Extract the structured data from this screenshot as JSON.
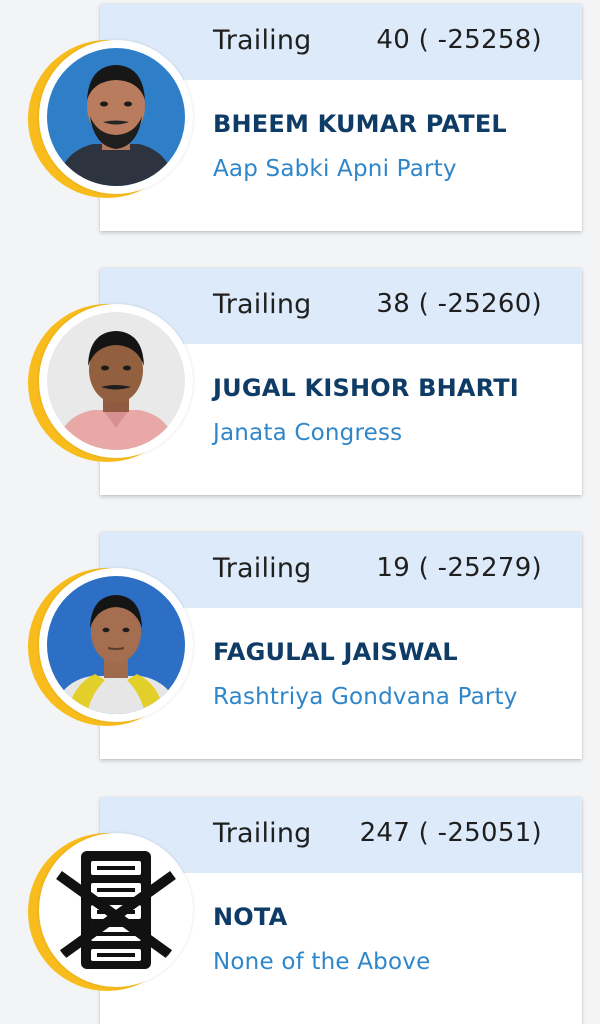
{
  "candidates": [
    {
      "status": "Trailing",
      "votes": "40 ( -25258)",
      "name": "BHEEM KUMAR PATEL",
      "party": "Aap Sabki Apni Party",
      "photo_icon": "candidate-photo-icon",
      "photo_bg": "#2f7fc8"
    },
    {
      "status": "Trailing",
      "votes": "38 ( -25260)",
      "name": "JUGAL KISHOR BHARTI",
      "party": "Janata Congress",
      "photo_icon": "candidate-photo-icon",
      "photo_bg": "#e9e9e9"
    },
    {
      "status": "Trailing",
      "votes": "19 ( -25279)",
      "name": "FAGULAL JAISWAL",
      "party": "Rashtriya Gondvana Party",
      "photo_icon": "candidate-photo-icon",
      "photo_bg": "#2c6fc4"
    },
    {
      "status": "Trailing",
      "votes": "247 ( -25051)",
      "name": "NOTA",
      "party": "None of the Above",
      "photo_icon": "nota-symbol-icon",
      "photo_bg": "#ffffff"
    }
  ],
  "colors": {
    "header_bg": "#ddeaf9",
    "name_color": "#0f3c66",
    "party_color": "#2f86c9",
    "ring_accent": "#f8bc1c"
  }
}
